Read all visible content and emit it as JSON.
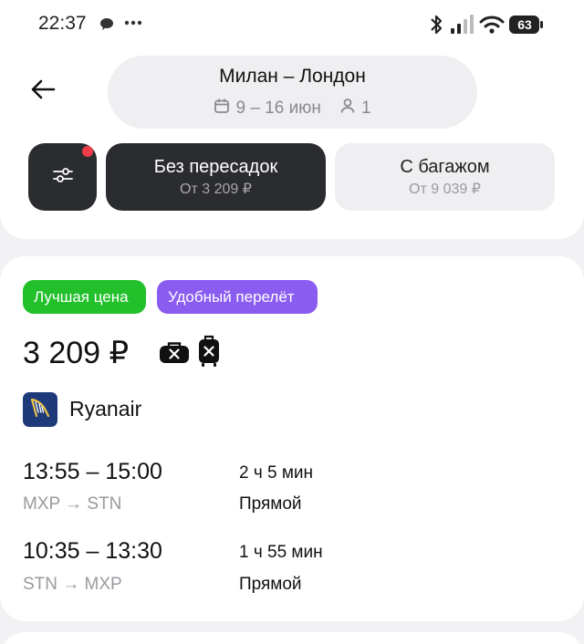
{
  "status_bar": {
    "time": "22:37",
    "battery": "63",
    "icons": [
      "chat-bubble-icon",
      "more-dots-icon",
      "bluetooth-icon",
      "signal-icon",
      "wifi-icon",
      "battery-icon"
    ]
  },
  "header": {
    "route_title": "Милан – Лондон",
    "dates": "9 – 16 июн",
    "passengers": "1"
  },
  "filters": {
    "has_active_filters": true,
    "chips": [
      {
        "title": "Без пересадок",
        "subtitle": "От 3 209 ₽",
        "active": true
      },
      {
        "title": "С багажом",
        "subtitle": "От 9 039 ₽",
        "active": false
      }
    ]
  },
  "offer": {
    "badges": [
      {
        "label": "Лучшая цена",
        "color": "#22c02b"
      },
      {
        "label": "Удобный перелёт",
        "color": "#8a5cf0"
      }
    ],
    "price": "3 209 ₽",
    "baggage_icons": [
      "no-baggage-icon",
      "no-carry-on-icon"
    ],
    "airline": "Ryanair",
    "segments": [
      {
        "time": "13:55 – 15:00",
        "route": "MXP → STN",
        "duration": "2 ч 5 мин",
        "type": "Прямой"
      },
      {
        "time": "10:35 – 13:30",
        "route": "STN → MXP",
        "duration": "1 ч 55 мин",
        "type": "Прямой"
      }
    ]
  },
  "colors": {
    "dark_chip": "#2b2c30",
    "light_chip": "#efeff1",
    "filter_dot": "#f03c4a",
    "airline_brand": "#1e3a78"
  }
}
